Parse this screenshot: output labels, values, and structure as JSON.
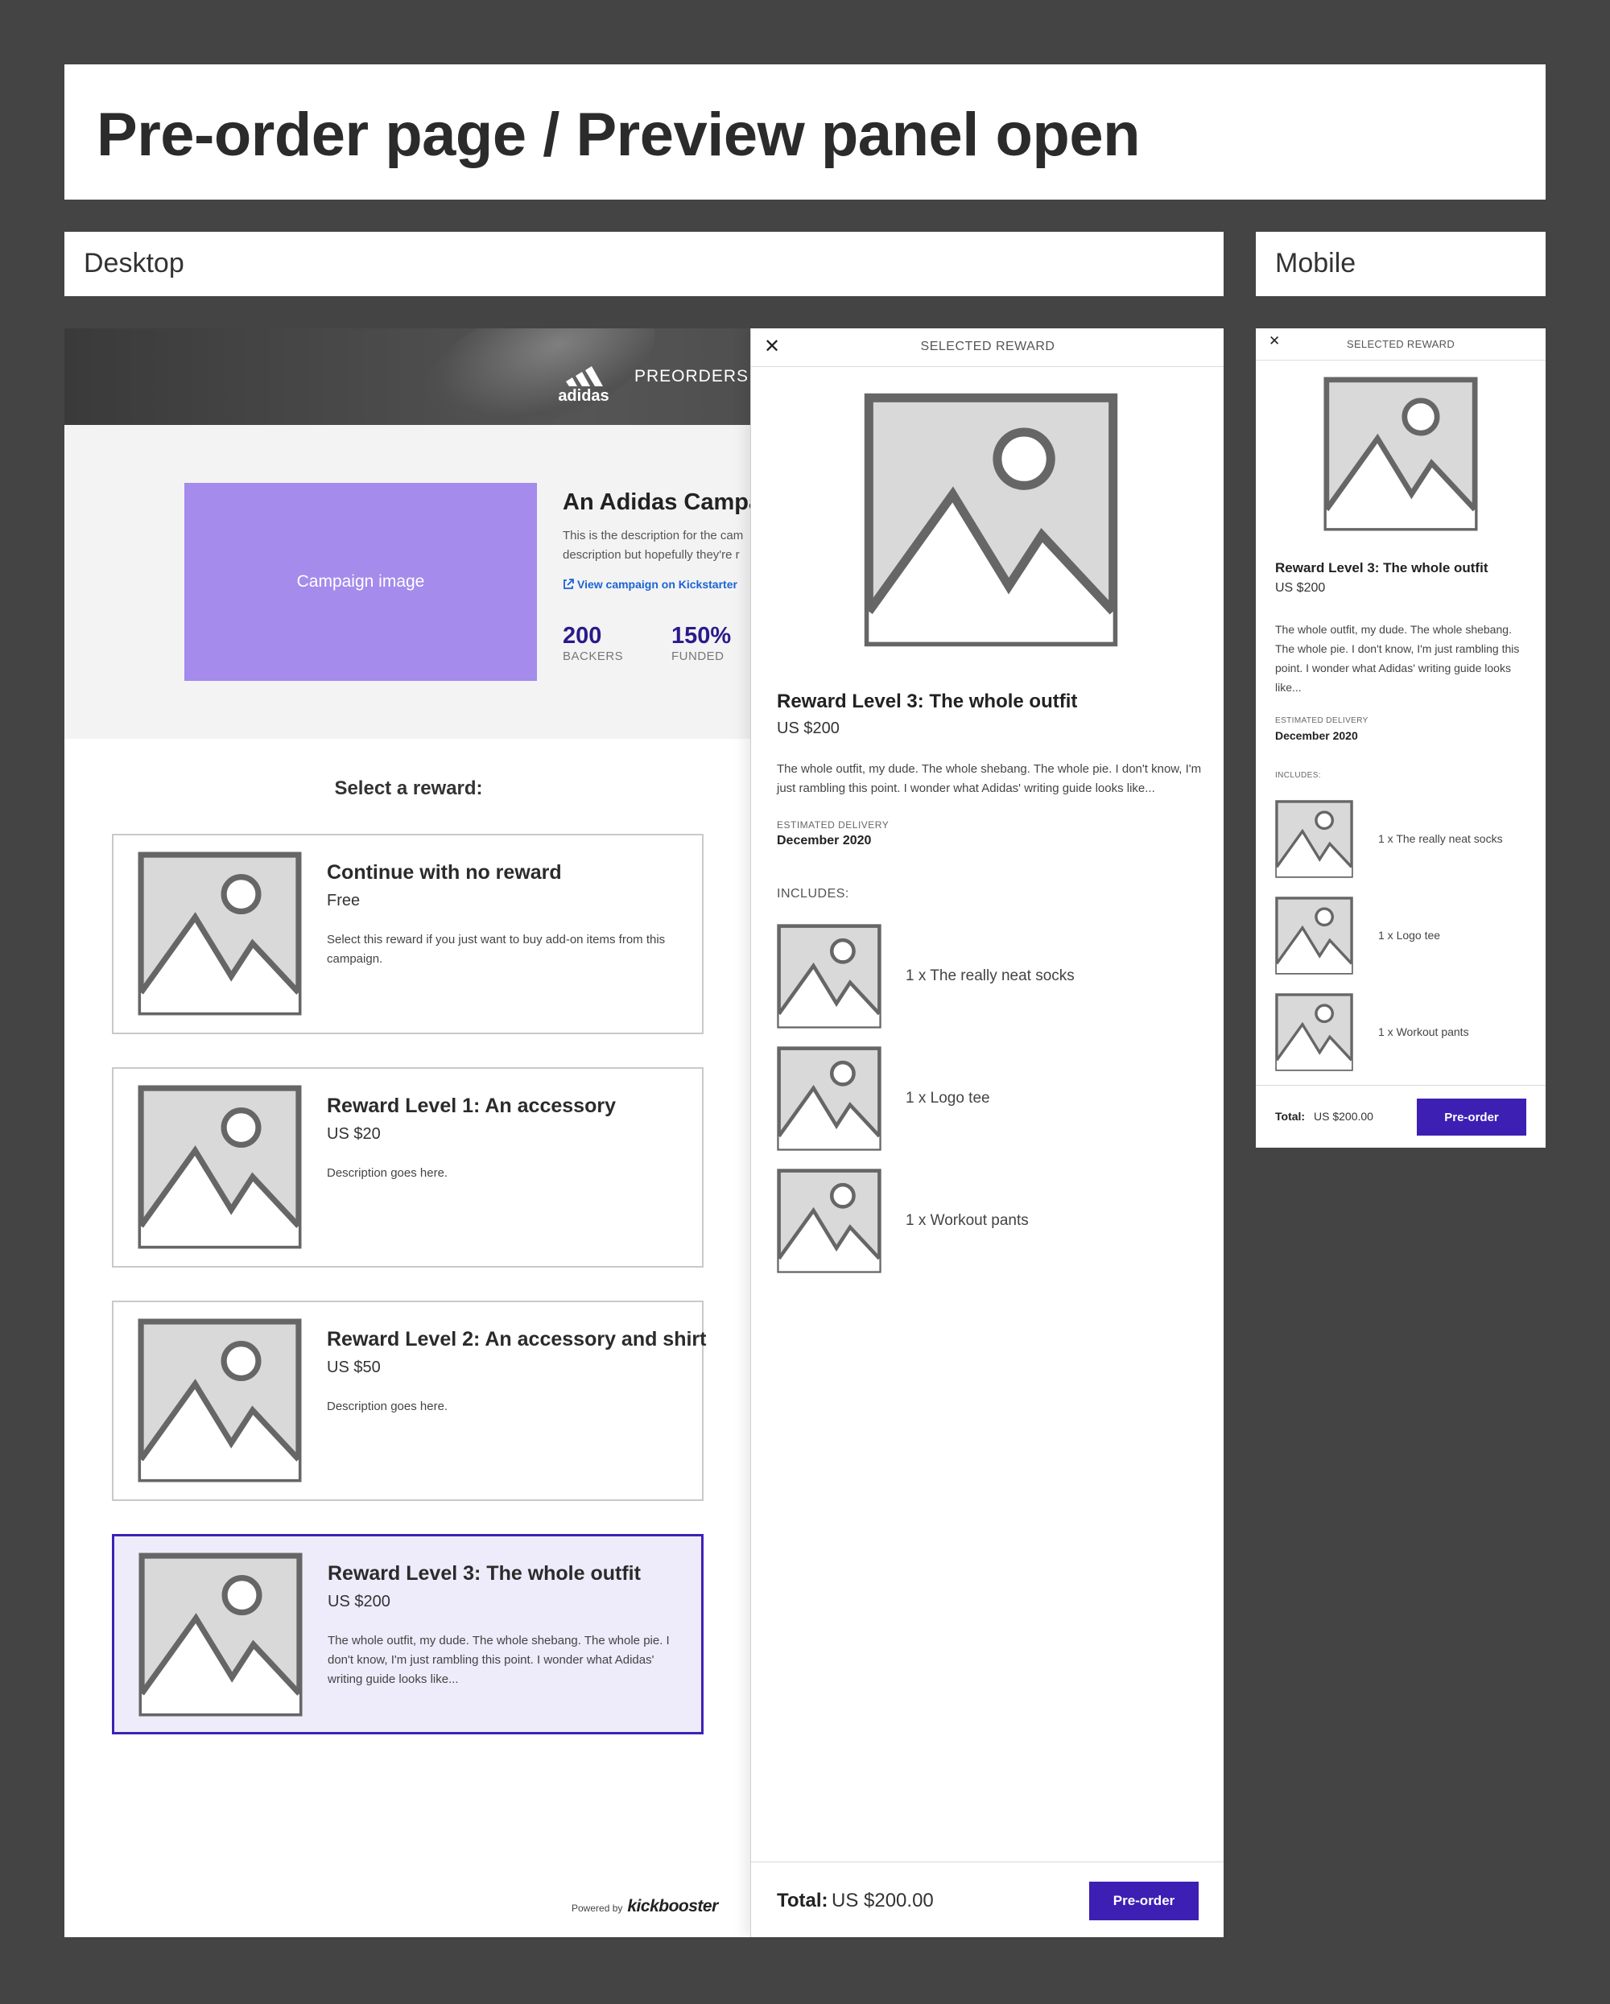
{
  "page": {
    "title": "Pre-order page / Preview panel open",
    "desktop_label": "Desktop",
    "mobile_label": "Mobile"
  },
  "colors": {
    "background": "#444444",
    "accent": "#3d1fb3",
    "campaign_image": "#a48bec",
    "selected_card_bg": "#eeebfa",
    "stat_color": "#2a1a8a",
    "link": "#1a63d6"
  },
  "header": {
    "brand": "adidas",
    "nav_label": "PREORDERS"
  },
  "campaign": {
    "image_label": "Campaign image",
    "title": "An Adidas Campaig",
    "description": "This is the description for the cam description but hopefully they're r",
    "link_label": "View campaign on Kickstarter",
    "stats": [
      {
        "value": "200",
        "label": "BACKERS"
      },
      {
        "value": "150%",
        "label": "FUNDED"
      }
    ]
  },
  "rewards": {
    "heading": "Select a reward:",
    "items": [
      {
        "title": "Continue with no reward",
        "price": "Free",
        "description": "Select this reward if you just want to buy add-on items from this campaign."
      },
      {
        "title": "Reward Level 1: An accessory",
        "price": "US $20",
        "description": "Description goes here."
      },
      {
        "title": "Reward Level 2: An accessory and shirt",
        "price": "US $50",
        "description": "Description goes here."
      },
      {
        "title": "Reward Level 3: The whole outfit",
        "price": "US $200",
        "description": "The whole outfit, my dude. The whole shebang. The whole pie. I don't know, I'm just rambling this point. I wonder what Adidas' writing guide looks like..."
      }
    ],
    "selected_index": 3
  },
  "footer": {
    "powered_by": "Powered by",
    "brand": "kickbooster"
  },
  "preview": {
    "header": "SELECTED REWARD",
    "title": "Reward Level 3: The whole outfit",
    "price": "US $200",
    "description": "The whole outfit, my dude. The whole shebang. The whole pie. I don't know, I'm just rambling this point. I wonder what Adidas' writing guide looks like...",
    "delivery_label": "ESTIMATED DELIVERY",
    "delivery_value": "December 2020",
    "includes_label": "INCLUDES:",
    "includes": [
      {
        "label": "1 x The really neat socks"
      },
      {
        "label": "1 x Logo tee"
      },
      {
        "label": "1 x Workout pants"
      }
    ],
    "total_label": "Total:",
    "total_value": "US $200.00",
    "button_label": "Pre-order"
  },
  "mobile": {
    "header": "SELECTED REWARD",
    "title": "Reward Level 3: The whole outfit",
    "price": "US $200",
    "description": "The whole outfit, my dude. The whole shebang. The whole pie. I don't know, I'm just rambling this point. I wonder what Adidas' writing guide looks like...",
    "delivery_label": "ESTIMATED DELIVERY",
    "delivery_value": "December 2020",
    "includes_label": "INCLUDES:",
    "includes": [
      {
        "label": "1 x The really neat socks"
      },
      {
        "label": "1 x Logo tee"
      },
      {
        "label": "1 x Workout pants"
      }
    ],
    "total_label": "Total:",
    "total_value": "US $200.00",
    "button_label": "Pre-order"
  }
}
